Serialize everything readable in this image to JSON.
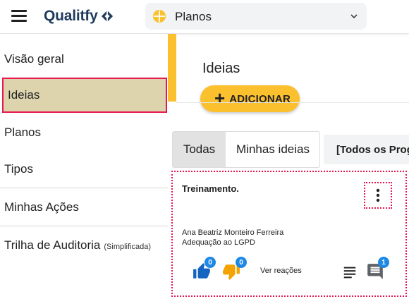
{
  "header": {
    "brand": "Qualitfy",
    "selector_label": "Planos",
    "selector_icon": "planos-icon"
  },
  "sidebar": {
    "items": [
      {
        "label": "Visão geral"
      },
      {
        "label": "Ideias"
      },
      {
        "label": "Planos"
      },
      {
        "label": "Tipos"
      },
      {
        "label": "Minhas Ações"
      },
      {
        "label": "Trilha de Auditoria",
        "sub": "(Simplificada)"
      }
    ]
  },
  "main": {
    "title": "Ideias",
    "add_label": "ADICIONAR",
    "tabs": [
      {
        "label": "Todas"
      },
      {
        "label": "Minhas ideias"
      }
    ],
    "filter_label": "[Todos os Programas]"
  },
  "card": {
    "title": "Treinamento.",
    "author": "Ana Beatriz Monteiro Ferreira",
    "category": "Adequação ao LGPD",
    "likes": "0",
    "dislikes": "0",
    "see_reactions": "Ver reações",
    "comments": "1"
  },
  "colors": {
    "accent": "#fbc02d",
    "selected_bg": "#ddd3ad",
    "highlight": "#e8174f",
    "like": "#1565c0",
    "dislike": "#f4a300",
    "badge": "#1e88e5",
    "brand": "#1f3b5c"
  }
}
